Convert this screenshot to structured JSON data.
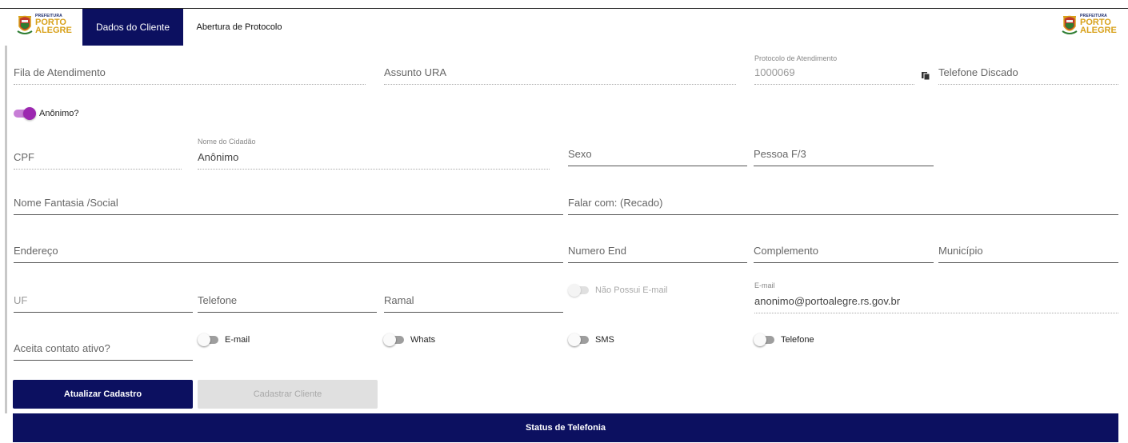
{
  "header": {
    "logo": {
      "line1": "PREFEITURA",
      "line2": "PORTO",
      "line3": "ALEGRE"
    },
    "tabs": [
      {
        "label": "Dados do Cliente",
        "active": true
      },
      {
        "label": "Abertura de Protocolo",
        "active": false
      }
    ]
  },
  "row1": {
    "fila": {
      "label": "Fila de Atendimento"
    },
    "assunto": {
      "label": "Assunto URA"
    },
    "protocolo": {
      "label": "Protocolo de Atendimento",
      "value": "1000069"
    },
    "telefone_discado": {
      "label": "Telefone Discado"
    }
  },
  "anonimo": {
    "label": "Anônimo?",
    "checked": true
  },
  "row2": {
    "cpf": {
      "label": "CPF"
    },
    "nome": {
      "label": "Nome do Cidadão",
      "value": "Anônimo"
    },
    "sexo": {
      "label": "Sexo"
    },
    "pessoa": {
      "label": "Pessoa F/3"
    }
  },
  "row3": {
    "fantasia": {
      "label": "Nome Fantasia /Social"
    },
    "falar": {
      "label": "Falar com: (Recado)"
    }
  },
  "row4": {
    "endereco": {
      "label": "Endereço"
    },
    "numero": {
      "label": "Numero End"
    },
    "complemento": {
      "label": "Complemento"
    },
    "municipio": {
      "label": "Município"
    }
  },
  "row5": {
    "uf": {
      "label": "UF"
    },
    "telefone": {
      "label": "Telefone"
    },
    "ramal": {
      "label": "Ramal"
    },
    "nao_possui_email": {
      "label": "Não Possui E-mail",
      "checked": false,
      "disabled": true
    },
    "email": {
      "label": "E-mail",
      "value": "anonimo@portoalegre.rs.gov.br"
    }
  },
  "row6": {
    "aceita": {
      "label": "Aceita contato ativo?"
    },
    "toggles": [
      {
        "label": "E-mail",
        "checked": false
      },
      {
        "label": "Whats",
        "checked": false
      },
      {
        "label": "SMS",
        "checked": false
      },
      {
        "label": "Telefone",
        "checked": false
      }
    ]
  },
  "actions": {
    "atualizar": "Atualizar Cadastro",
    "cadastrar": "Cadastrar Cliente",
    "status": "Status de Telefonia"
  },
  "colors": {
    "primary": "#0c1060",
    "toggle_on": "#9c27b0",
    "logo_gold": "#d8a11a"
  }
}
